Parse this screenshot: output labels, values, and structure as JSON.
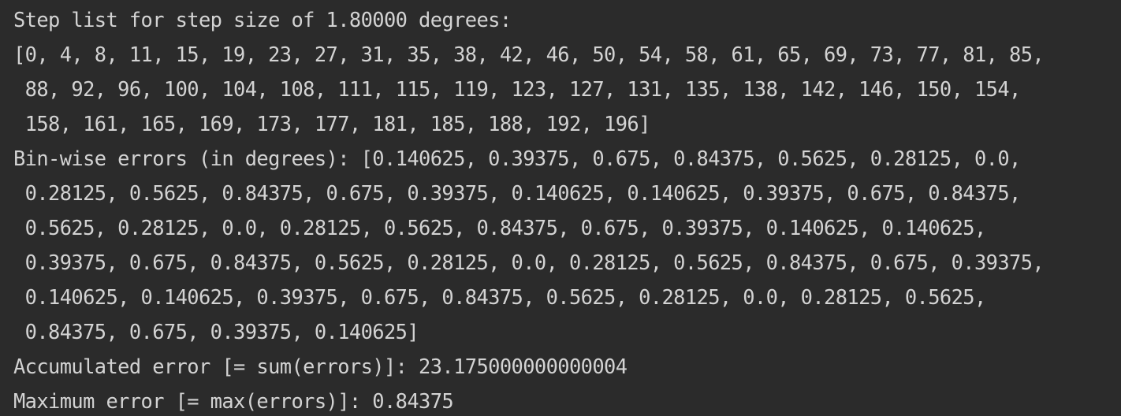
{
  "console": {
    "lines": [
      "Step list for step size of 1.80000 degrees:",
      "[0, 4, 8, 11, 15, 19, 23, 27, 31, 35, 38, 42, 46, 50, 54, 58, 61, 65, 69, 73, 77, 81, 85,",
      " 88, 92, 96, 100, 104, 108, 111, 115, 119, 123, 127, 131, 135, 138, 142, 146, 150, 154,",
      " 158, 161, 165, 169, 173, 177, 181, 185, 188, 192, 196]",
      "Bin-wise errors (in degrees): [0.140625, 0.39375, 0.675, 0.84375, 0.5625, 0.28125, 0.0,",
      " 0.28125, 0.5625, 0.84375, 0.675, 0.39375, 0.140625, 0.140625, 0.39375, 0.675, 0.84375,",
      " 0.5625, 0.28125, 0.0, 0.28125, 0.5625, 0.84375, 0.675, 0.39375, 0.140625, 0.140625,",
      " 0.39375, 0.675, 0.84375, 0.5625, 0.28125, 0.0, 0.28125, 0.5625, 0.84375, 0.675, 0.39375,",
      " 0.140625, 0.140625, 0.39375, 0.675, 0.84375, 0.5625, 0.28125, 0.0, 0.28125, 0.5625,",
      " 0.84375, 0.675, 0.39375, 0.140625]",
      "Accumulated error [= sum(errors)]: 23.175000000000004",
      "Maximum error [= max(errors)]: 0.84375"
    ]
  }
}
